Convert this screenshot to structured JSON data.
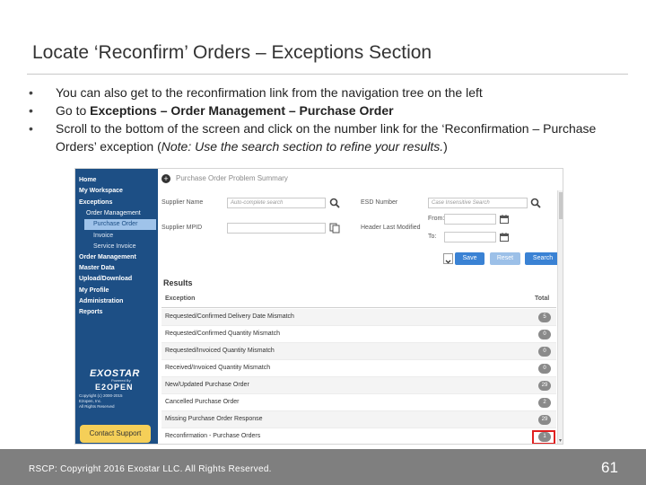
{
  "slide": {
    "title": "Locate ‘Reconfirm’ Orders – Exceptions Section",
    "bullets": [
      {
        "marker": "•",
        "text_a": "You can also get to the reconfirmation link from the navigation tree on the left"
      },
      {
        "marker": "•",
        "text_a": "Go to ",
        "bold": "Exceptions – Order Management – Purchase Order"
      },
      {
        "marker": "•",
        "text_a": "Scroll to the bottom of the screen and click on the number link for the ‘Reconfirmation – Purchase Orders’ exception (",
        "italic": "Note: Use the search section to refine your results.",
        "text_b": ")"
      }
    ]
  },
  "app": {
    "nav": {
      "items": [
        {
          "label": "Home",
          "level": 0
        },
        {
          "label": "My Workspace",
          "level": 0
        },
        {
          "label": "Exceptions",
          "level": 0
        },
        {
          "label": "Order Management",
          "level": 1
        },
        {
          "label": "Purchase Order",
          "level": 2,
          "active": true
        },
        {
          "label": "Invoice",
          "level": 2
        },
        {
          "label": "Service Invoice",
          "level": 2
        },
        {
          "label": "Order Management",
          "level": 0
        },
        {
          "label": "Master Data",
          "level": 0
        },
        {
          "label": "Upload/Download",
          "level": 0
        },
        {
          "label": "My Profile",
          "level": 0
        },
        {
          "label": "Administration",
          "level": 0
        },
        {
          "label": "Reports",
          "level": 0
        }
      ],
      "logo": "EXOSTAR",
      "powered_by": "Powered By",
      "e2open": "E2OPEN",
      "copyright_lines": [
        "Copyright (c) 2000-2015",
        "E2open, Inc.",
        "All Rights Reserved"
      ],
      "contact_label": "Contact Support"
    },
    "filters": {
      "section_title": "Purchase Order Problem Summary",
      "supplier_name_label": "Supplier Name",
      "supplier_name_placeholder": "Auto-complete search",
      "esd_number_label": "ESD Number",
      "esd_number_placeholder": "Case Insensitive Search",
      "supplier_mpid_label": "Supplier MPID",
      "header_last_modified_label": "Header Last Modified",
      "from_label": "From:",
      "to_label": "To:",
      "save_label": "Save",
      "reset_label": "Reset",
      "search_label": "Search"
    },
    "results": {
      "title": "Results",
      "col_exception": "Exception",
      "col_total": "Total",
      "rows": [
        {
          "exception": "Requested/Confirmed Delivery Date Mismatch",
          "total": "5"
        },
        {
          "exception": "Requested/Confirmed Quantity Mismatch",
          "total": "0"
        },
        {
          "exception": "Requested/Invoiced Quantity Mismatch",
          "total": "0"
        },
        {
          "exception": "Received/Invoiced Quantity Mismatch",
          "total": "0"
        },
        {
          "exception": "New/Updated Purchase Order",
          "total": "29"
        },
        {
          "exception": "Cancelled Purchase Order",
          "total": "2"
        },
        {
          "exception": "Missing Purchase Order Response",
          "total": "29"
        },
        {
          "exception": "Reconfirmation - Purchase Orders",
          "total": "1",
          "highlighted": true
        }
      ]
    }
  },
  "footer": {
    "copyright": "RSCP: Copyright 2016 Exostar LLC. All Rights Reserved.",
    "page_number": "61"
  },
  "colors": {
    "nav_bg": "#1d4f85",
    "nav_active": "#9fc3ea",
    "button_primary": "#3a82d4",
    "button_disabled": "#9cc0e8",
    "highlight": "#e02020",
    "contact_button": "#f5cf58",
    "footer_bg": "#7f7f7f"
  }
}
